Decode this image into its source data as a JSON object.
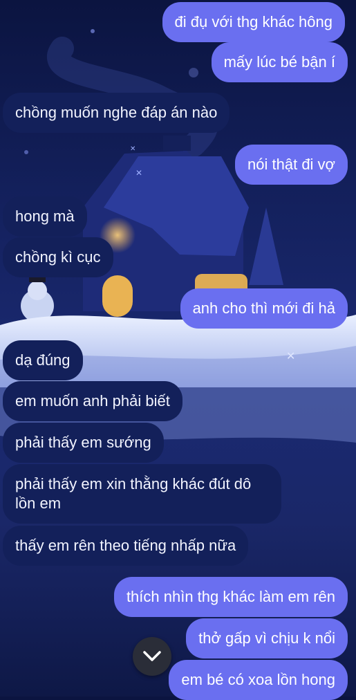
{
  "messages": [
    {
      "side": "out",
      "text": "đi đụ với thg khác hông"
    },
    {
      "side": "out",
      "text": "mấy lúc bé bận í"
    },
    {
      "side": "in",
      "text": "chồng muốn nghe đáp án nào"
    },
    {
      "side": "out",
      "text": "nói thật đi vợ"
    },
    {
      "side": "in",
      "text": "hong mà"
    },
    {
      "side": "in",
      "text": "chồng kì cục"
    },
    {
      "side": "out",
      "text": "anh cho thì mới đi hả"
    },
    {
      "side": "in",
      "text": "dạ đúng"
    },
    {
      "side": "in",
      "text": "em muốn anh phải biết"
    },
    {
      "side": "in",
      "text": "phải thấy em sướng"
    },
    {
      "side": "in",
      "text": "phải thấy em xin thằng khác đút dô lồn em"
    },
    {
      "side": "in",
      "text": "thấy em rên theo tiếng nhấp nữa"
    },
    {
      "side": "out",
      "text": "thích nhìn thg khác làm em rên"
    },
    {
      "side": "out",
      "text": "thở gấp vì chịu k nổi"
    },
    {
      "side": "out",
      "text": "em bé có xoa lồn hong"
    }
  ],
  "scroll_button": {
    "icon": "chevron-down-icon"
  },
  "colors": {
    "incoming_bubble": "#13205a",
    "outgoing_bubble": "#6a6ff0",
    "background": "#14215e"
  }
}
